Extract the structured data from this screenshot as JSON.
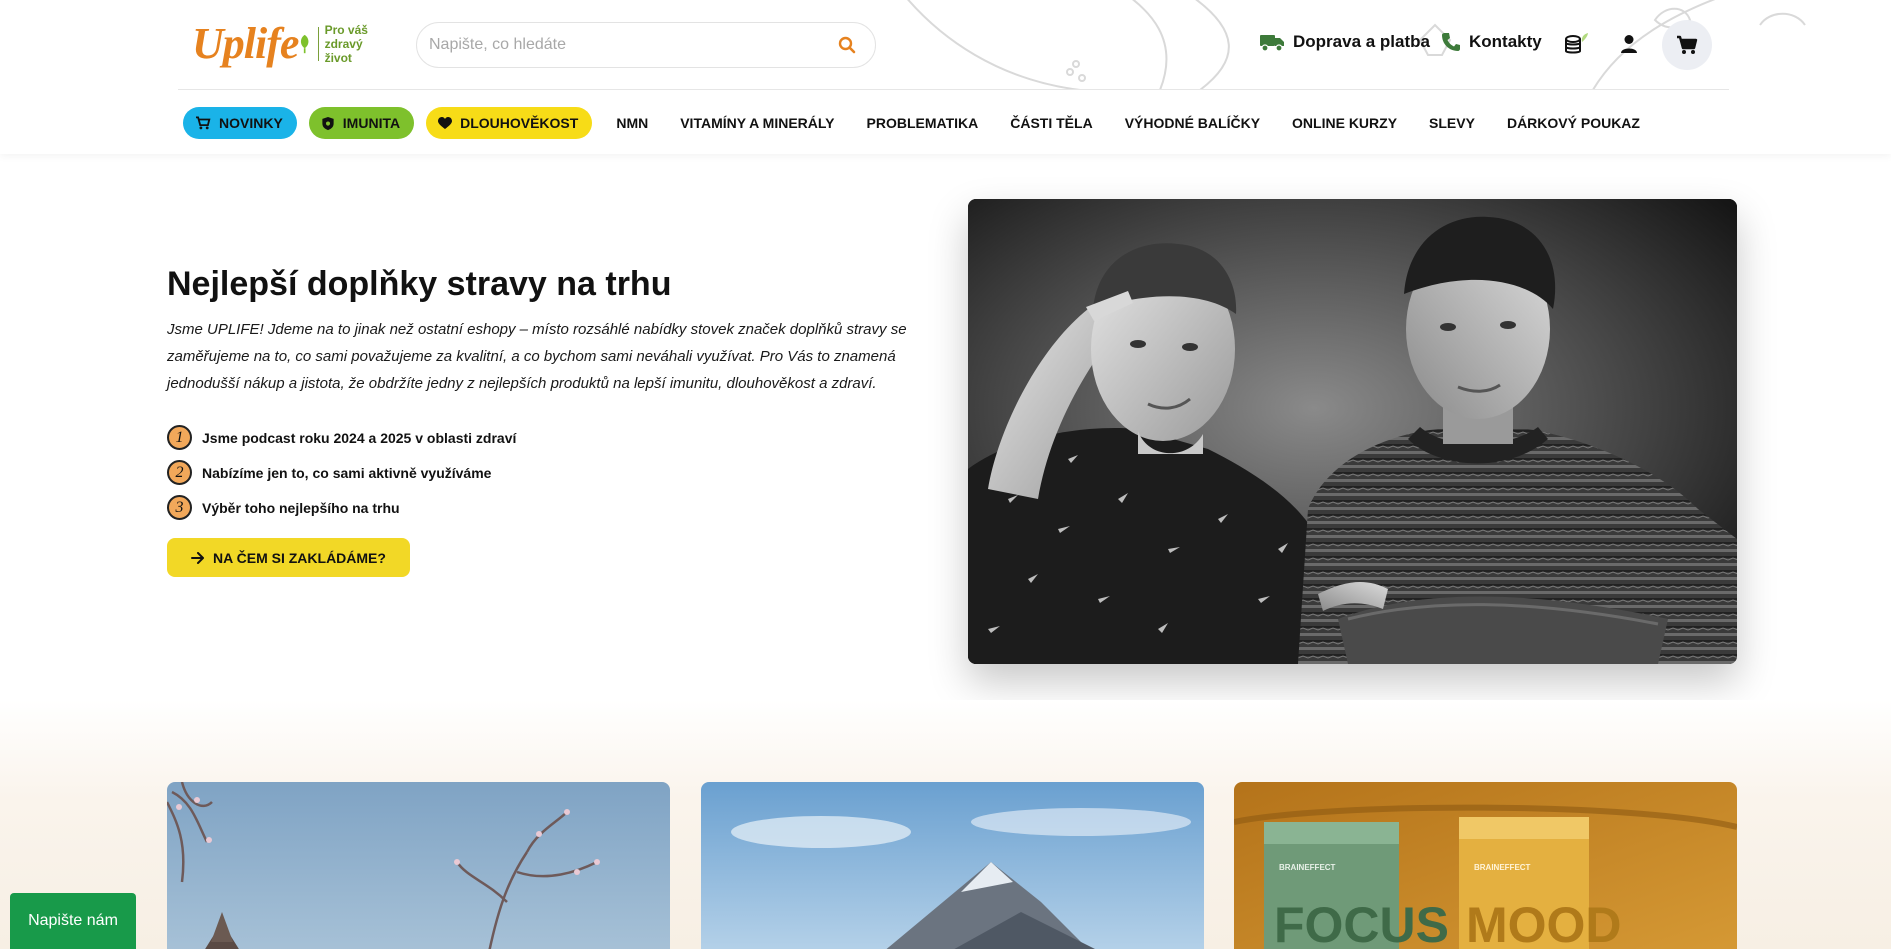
{
  "header": {
    "logo": {
      "wordmark": "Uplife",
      "tagline_line1": "Pro váš",
      "tagline_line2": "zdravý život"
    },
    "search": {
      "placeholder": "Napište, co hledáte",
      "value": ""
    },
    "shipping_label": "Doprava a platba",
    "contacts_label": "Kontakty"
  },
  "nav": {
    "pills": [
      {
        "label": "NOVINKY",
        "icon": "cart-icon"
      },
      {
        "label": "IMUNITA",
        "icon": "shield-icon"
      },
      {
        "label": "DLOUHOVĚKOST",
        "icon": "heart-icon"
      }
    ],
    "items": [
      "NMN",
      "VITAMÍNY A MINERÁLY",
      "PROBLEMATIKA",
      "ČÁSTI TĚLA",
      "VÝHODNÉ BALÍČKY",
      "ONLINE KURZY",
      "SLEVY",
      "DÁRKOVÝ POUKAZ"
    ]
  },
  "hero": {
    "title": "Nejlepší doplňky stravy na trhu",
    "text": "Jsme UPLIFE! Jdeme na to jinak než ostatní eshopy – místo rozsáhlé nabídky stovek značek doplňků stravy se zaměřujeme na to, co sami považujeme za kvalitní, a co bychom sami neváhali využívat. Pro Vás to znamená jednodušší nákup a jistota, že obdržíte jedny z nejlepších produktů na lepší imunitu, dlouhověkost a zdraví.",
    "bullets": [
      {
        "num": "1",
        "text": "Jsme podcast roku 2024 a 2025 v oblasti zdraví"
      },
      {
        "num": "2",
        "text": "Nabízíme jen to, co sami aktivně využíváme"
      },
      {
        "num": "3",
        "text": "Výběr toho nejlepšího na trhu"
      }
    ],
    "cta": "NA ČEM SI ZAKLÁDÁME?"
  },
  "cards": {
    "card3": {
      "box1": "FOCUS",
      "box2": "MOOD",
      "brand": "BRAINEFFECT"
    }
  },
  "chat": {
    "label": "Napište nám"
  },
  "colors": {
    "brand_orange": "#e6821f",
    "brand_green": "#6a9a2a",
    "pill_blue": "#1ab3e8",
    "pill_green": "#7ec12c",
    "pill_yellow": "#f7dc17",
    "cta_yellow": "#f2d826",
    "chat_green": "#189a4a"
  }
}
